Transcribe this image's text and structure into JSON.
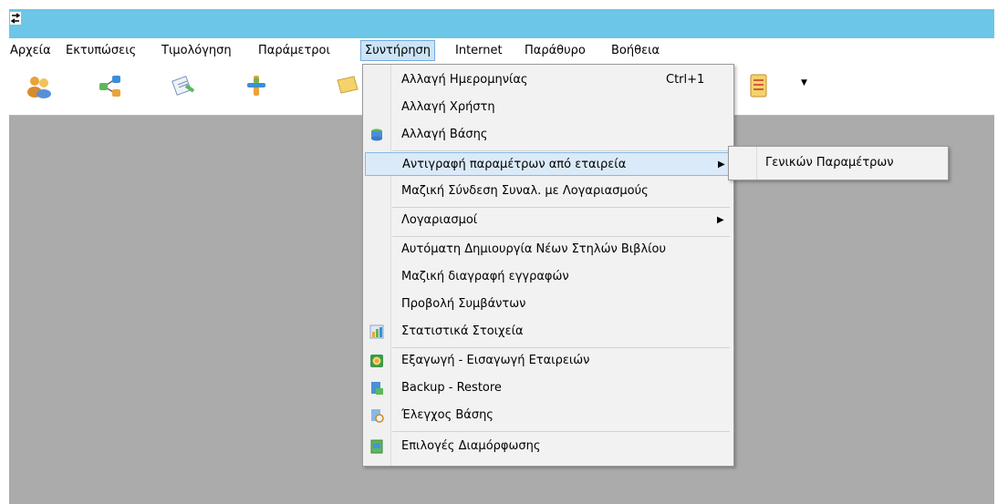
{
  "menubar": {
    "items": [
      {
        "label": "Αρχεία"
      },
      {
        "label": "Εκτυπώσεις"
      },
      {
        "label": "Τιμολόγηση"
      },
      {
        "label": "Παράμετροι"
      },
      {
        "label": "Συντήρηση"
      },
      {
        "label": "Internet"
      },
      {
        "label": "Παράθυρο"
      },
      {
        "label": "Βοήθεια"
      }
    ]
  },
  "toolbar": {
    "icons": [
      "users-icon",
      "network-icon",
      "document-pen-icon",
      "pin-icon",
      "note-icon",
      "checklist-icon",
      "dropdown-arrow-icon"
    ],
    "dropdown_glyph": "▼"
  },
  "dropdown": {
    "items": [
      {
        "label": "Αλλαγή Ημερομηνίας",
        "shortcut": "Ctrl+1"
      },
      {
        "label": "Αλλαγή Χρήστη"
      },
      {
        "label": "Αλλαγή Βάσης",
        "icon": "database-icon"
      },
      {
        "label": "Αντιγραφή παραμέτρων από εταιρεία",
        "arrow": "▶"
      },
      {
        "label": "Μαζική Σύνδεση Συναλ. με Λογαριασμούς"
      },
      {
        "label": "Λογαριασμοί",
        "arrow": "▶"
      },
      {
        "label": "Αυτόματη Δημιουργία Νέων Στηλών Βιβλίου"
      },
      {
        "label": "Μαζική διαγραφή εγγραφών"
      },
      {
        "label": "Προβολή Συμβάντων"
      },
      {
        "label": "Στατιστικά Στοιχεία",
        "icon": "statistics-icon"
      },
      {
        "label": "Εξαγωγή - Εισαγωγή Εταιρειών",
        "icon": "export-import-icon"
      },
      {
        "label": "Backup - Restore",
        "icon": "backup-icon"
      },
      {
        "label": "Έλεγχος Βάσης",
        "icon": "database-check-icon"
      },
      {
        "label": "Επιλογές Διαμόρφωσης",
        "icon": "settings-sheet-icon"
      }
    ]
  },
  "submenu": {
    "items": [
      {
        "label": "Γενικών Παραμέτρων"
      }
    ]
  }
}
